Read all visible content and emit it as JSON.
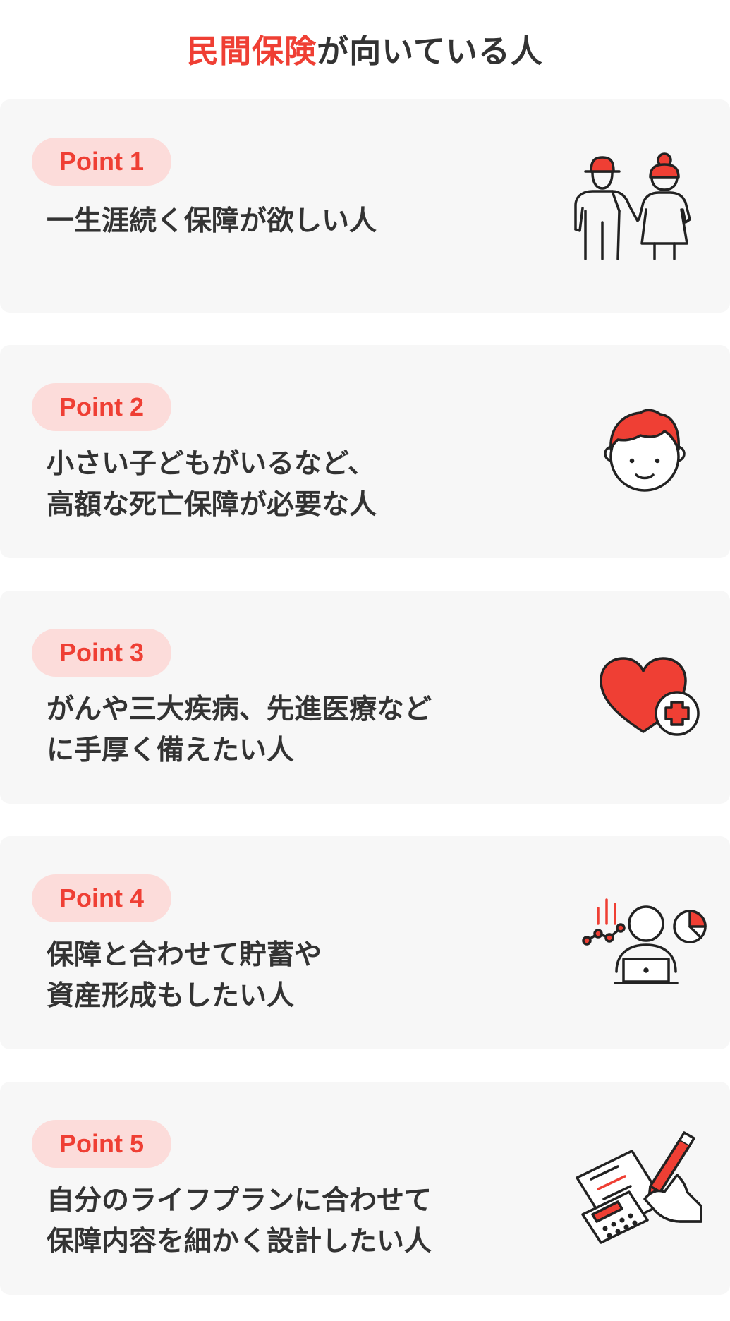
{
  "header": {
    "title_accent": "民間保険",
    "title_rest": "が向いている人"
  },
  "points": [
    {
      "badge": "Point 1",
      "lines": [
        "一生涯続く保障が欲しい人"
      ],
      "icon": "elderly-couple-icon"
    },
    {
      "badge": "Point 2",
      "lines": [
        "小さい子どもがいるなど、",
        "高額な死亡保障が必要な人"
      ],
      "icon": "child-face-icon"
    },
    {
      "badge": "Point 3",
      "lines": [
        "がんや三大疾病、先進医療など",
        "に手厚く備えたい人"
      ],
      "icon": "heart-plus-icon"
    },
    {
      "badge": "Point 4",
      "lines": [
        "保障と合わせて貯蓄や",
        "資産形成もしたい人"
      ],
      "icon": "person-laptop-chart-icon"
    },
    {
      "badge": "Point 5",
      "lines": [
        "自分のライフプランに合わせて",
        "保障内容を細かく設計したい人"
      ],
      "icon": "document-calculator-pen-icon"
    }
  ],
  "colors": {
    "accent": "#ef3f34",
    "badge_bg": "#fcdcda",
    "card_bg": "#f7f7f7",
    "text": "#333333",
    "outline": "#222222"
  }
}
